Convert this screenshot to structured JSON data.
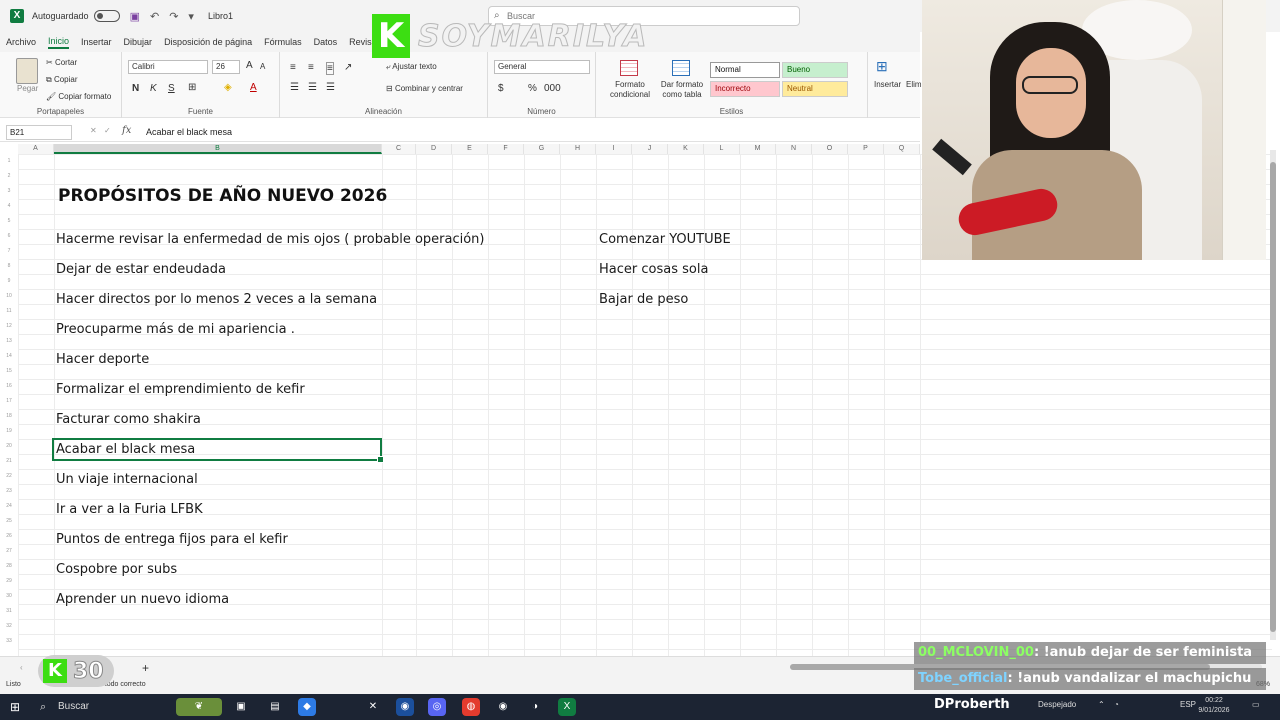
{
  "titlebar": {
    "autosave_label": "Autoguardado",
    "filename": "Libro1",
    "search_placeholder": "Buscar"
  },
  "brand": {
    "k": "K",
    "name": "SOYMARILYA"
  },
  "ribbon_tabs": [
    "Archivo",
    "Inicio",
    "Insertar",
    "Dibujar",
    "Disposición de página",
    "Fórmulas",
    "Datos",
    "Revis"
  ],
  "ribbon": {
    "paste": "Pegar",
    "cut": "Cortar",
    "copy": "Copiar",
    "copy_format": "Copiar formato",
    "clipboard_label": "Portapapeles",
    "font_name": "Calibri",
    "font_size": "26",
    "font_label": "Fuente",
    "wrap_text": "Ajustar texto",
    "merge_center": "Combinar y centrar",
    "alignment_label": "Alineación",
    "number_format": "General",
    "number_label": "Número",
    "cond_format": "Formato condicional",
    "format_table": "Dar formato como tabla",
    "styles": {
      "normal": "Normal",
      "bueno": "Bueno",
      "incorrecto": "Incorrecto",
      "neutral": "Neutral"
    },
    "styles_label": "Estilos",
    "insert": "Insertar",
    "delete": "Elim"
  },
  "formula_bar": {
    "name_box": "B21",
    "fx": "fx",
    "content": "Acabar el black mesa"
  },
  "columns": [
    "A",
    "B",
    "C",
    "D",
    "E",
    "F",
    "G",
    "H",
    "I",
    "J",
    "K",
    "L",
    "M",
    "N",
    "O",
    "P",
    "Q"
  ],
  "sheet": {
    "title": "PROPÓSITOS DE AÑO NUEVO 2026",
    "list_b": [
      "Hacerme revisar la enfermedad de mis ojos ( probable operación)",
      "Dejar de estar endeudada",
      "Hacer directos por lo menos  2 veces a la semana",
      "Preocuparme más de mi apariencia .",
      "Hacer deporte",
      "Formalizar el emprendimiento de kefir",
      "Facturar como shakira",
      "Acabar el black mesa",
      "Un viaje internacional",
      "Ir a ver a la Furia LFBK",
      "Puntos de entrega fijos para el kefir",
      "Cospobre por subs",
      "Aprender un nuevo idioma"
    ],
    "list_i": [
      "Comenzar YOUTUBE",
      "Hacer cosas sola",
      "Bajar de peso"
    ]
  },
  "status": {
    "ready": "Listo",
    "accessibility": "Accesibilidad: todo correcto",
    "zoom": "68%",
    "add_sheet": "+"
  },
  "badge": {
    "k": "K",
    "number": "30"
  },
  "chat": [
    {
      "user": "00_MCLOVIN_00",
      "msg": ": !anub dejar de ser feminista"
    },
    {
      "user": "Tobe_official",
      "msg": ": !anub vandalizar el machupichu"
    }
  ],
  "taskbar": {
    "search": "Buscar",
    "user": "DProberth",
    "weather": "Despejado",
    "lang": "ESP",
    "time": "00:22",
    "date": "9/01/2026"
  }
}
